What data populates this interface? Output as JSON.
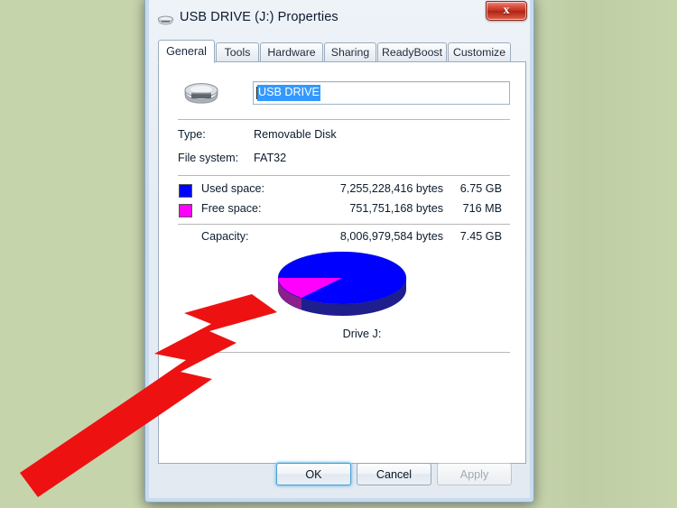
{
  "window": {
    "title": "USB DRIVE (J:) Properties",
    "title_icon": "removable-drive-icon",
    "close_label": "x"
  },
  "tabs": [
    {
      "label": "General",
      "active": true
    },
    {
      "label": "Tools",
      "active": false
    },
    {
      "label": "Hardware",
      "active": false
    },
    {
      "label": "Sharing",
      "active": false
    },
    {
      "label": "ReadyBoost",
      "active": false
    },
    {
      "label": "Customize",
      "active": false
    }
  ],
  "general": {
    "volume_name_value": "USB DRIVE",
    "volume_name_placeholder": "",
    "type_label": "Type:",
    "type_value": "Removable Disk",
    "filesystem_label": "File system:",
    "filesystem_value": "FAT32",
    "used_space": {
      "label": "Used space:",
      "bytes": "7,255,228,416 bytes",
      "human": "6.75 GB",
      "color": "#0000ff"
    },
    "free_space": {
      "label": "Free space:",
      "bytes": "751,751,168 bytes",
      "human": "716 MB",
      "color": "#ff00ff"
    },
    "capacity": {
      "label": "Capacity:",
      "bytes": "8,006,979,584 bytes",
      "human": "7.45 GB"
    },
    "drive_caption": "Drive J:"
  },
  "chart_data": {
    "type": "pie",
    "title": "Drive J:",
    "labels": [
      "Used space",
      "Free space"
    ],
    "values": [
      7255228416,
      751751168
    ],
    "percent": [
      90.6,
      9.4
    ],
    "colors": [
      "#0000ff",
      "#ff00ff"
    ],
    "side_colors": [
      "#1b1b8f",
      "#8f1b8f"
    ],
    "legend_position": "above",
    "three_d": true
  },
  "buttons": {
    "ok": "OK",
    "cancel": "Cancel",
    "apply": "Apply"
  },
  "annotation": {
    "arrow_color": "#ee1111",
    "points_at": "free-space-pie-slice"
  },
  "theme": {
    "desktop_background": "#c6d4ac",
    "selection_blue": "#3399ff",
    "close_red": "#c32e1c"
  }
}
